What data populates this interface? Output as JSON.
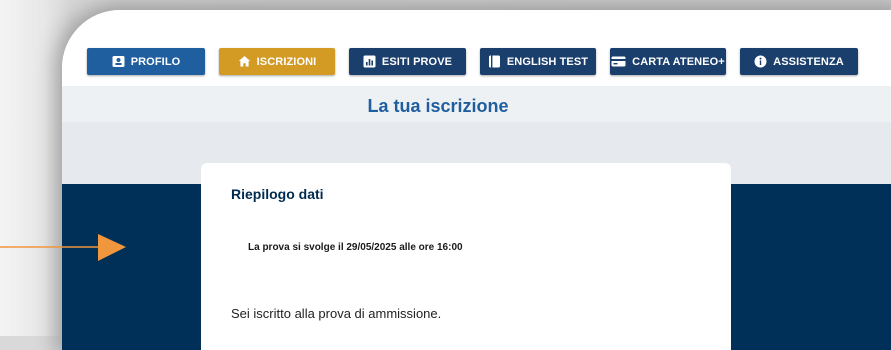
{
  "nav": {
    "profilo": "PROFILO",
    "iscrizioni": "ISCRIZIONI",
    "esiti_prove": "ESITI PROVE",
    "english_test": "ENGLISH TEST",
    "carta_ateneo": "CARTA ATENEO+",
    "assistenza": "ASSISTENZA"
  },
  "page": {
    "title": "La tua iscrizione"
  },
  "card": {
    "title": "Riepilogo dati",
    "notice": "La prova si svolge il 29/05/2025 alle ore 16:00",
    "status": "Sei iscritto alla prova di ammissione."
  },
  "colors": {
    "primary_blue": "#1f5e9f",
    "active_gold": "#d39b24",
    "dark_navy": "#003058",
    "pointer_orange": "#f0963c"
  },
  "icons": {
    "profilo": "id-card-icon",
    "iscrizioni": "home-icon",
    "esiti_prove": "bar-chart-icon",
    "english_test": "book-icon",
    "carta_ateneo": "credit-card-icon",
    "assistenza": "info-icon",
    "pointer": "arrow-right-icon"
  }
}
